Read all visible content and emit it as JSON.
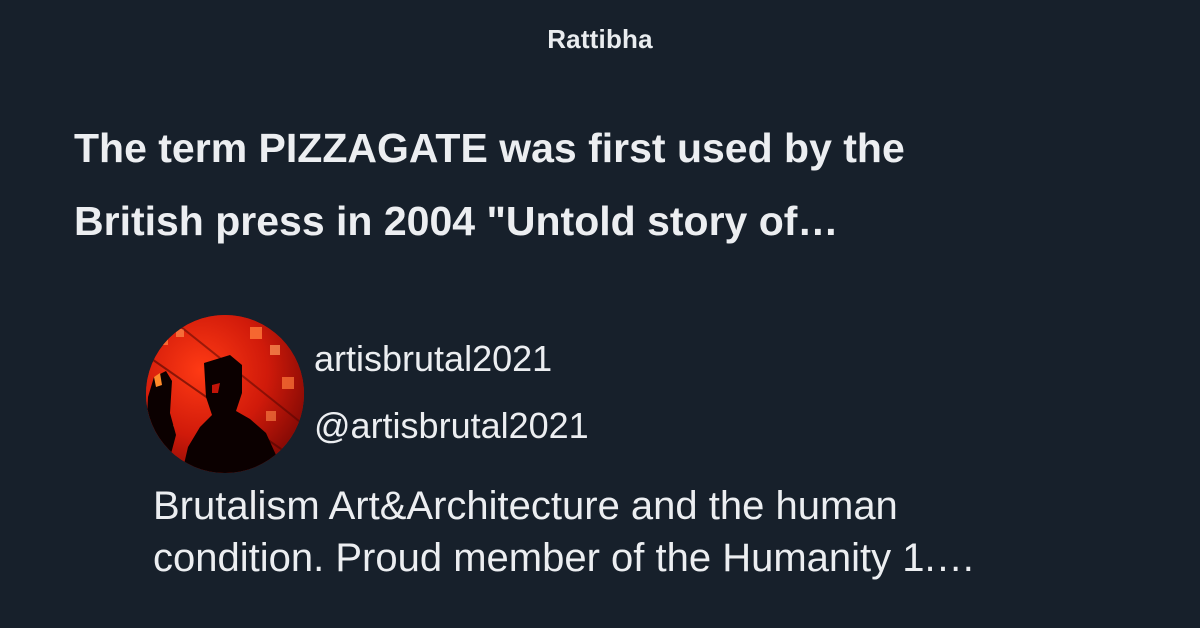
{
  "site": {
    "name": "Rattibha"
  },
  "thread": {
    "title_lines": [
      "The term PIZZAGATE was first used by the",
      "British press in 2004 \"Untold story of…"
    ]
  },
  "author": {
    "display_name": "artisbrutal2021",
    "handle": "@artisbrutal2021",
    "bio_lines": [
      "Brutalism Art&Architecture and the human",
      "condition. Proud member of the Humanity 1.…"
    ],
    "avatar": {
      "icon": "profile-avatar",
      "colors": {
        "background": "#c21408",
        "accent": "#ff5a1f",
        "figure": "#000000"
      }
    }
  },
  "theme": {
    "background": "#17202b",
    "text": "#eceef1"
  }
}
